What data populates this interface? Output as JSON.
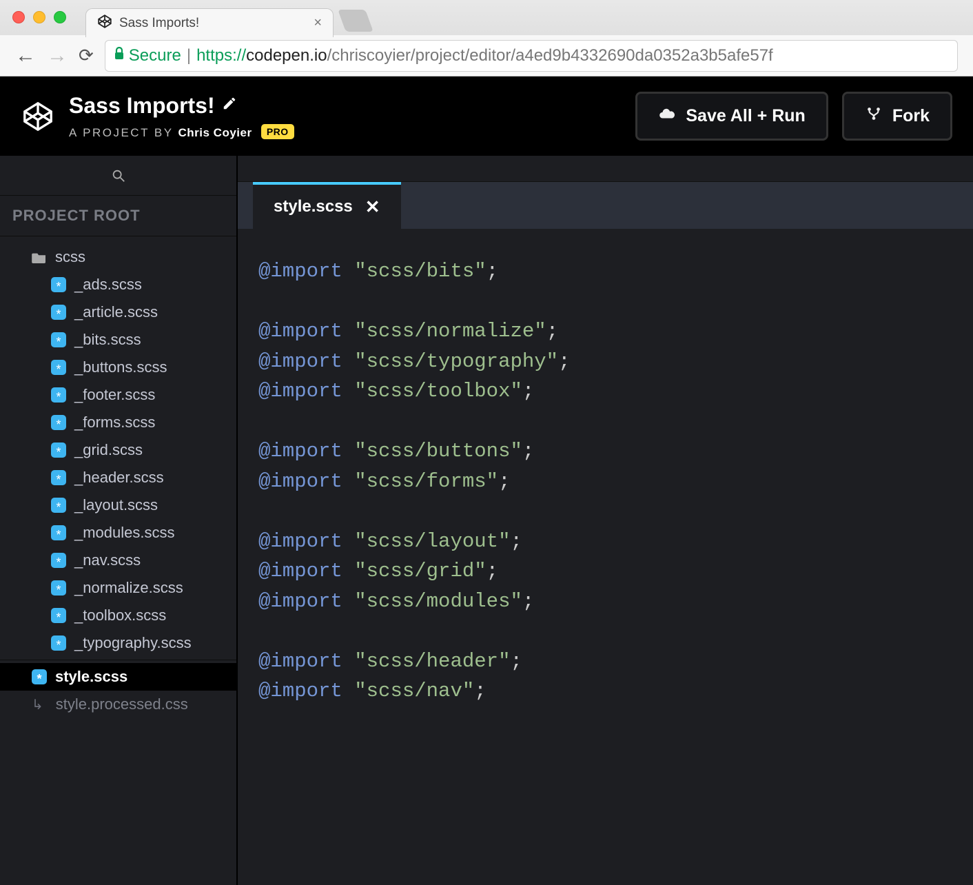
{
  "browser": {
    "tab_title": "Sass Imports!",
    "secure_label": "Secure",
    "url_proto": "https://",
    "url_host": "codepen.io",
    "url_path": "/chriscoyier/project/editor/a4ed9b4332690da0352a3b5afe57f"
  },
  "header": {
    "project_title": "Sass Imports!",
    "byline_prefix": "A PROJECT BY",
    "byline_author": "Chris Coyier",
    "pro_badge": "PRO",
    "save_button": "Save All + Run",
    "fork_button": "Fork"
  },
  "sidebar": {
    "root_label": "PROJECT ROOT",
    "folder": "scss",
    "files": [
      "_ads.scss",
      "_article.scss",
      "_bits.scss",
      "_buttons.scss",
      "_footer.scss",
      "_forms.scss",
      "_grid.scss",
      "_header.scss",
      "_layout.scss",
      "_modules.scss",
      "_nav.scss",
      "_normalize.scss",
      "_toolbox.scss",
      "_typography.scss"
    ],
    "selected_file": "style.scss",
    "processed_file": "style.processed.css"
  },
  "editor": {
    "open_tab": "style.scss",
    "code_lines": [
      {
        "kw": "@import",
        "str": "\"scss/bits\"",
        "tail": ";"
      },
      {
        "blank": true
      },
      {
        "kw": "@import",
        "str": "\"scss/normalize\"",
        "tail": ";"
      },
      {
        "kw": "@import",
        "str": "\"scss/typography\"",
        "tail": ";"
      },
      {
        "kw": "@import",
        "str": "\"scss/toolbox\"",
        "tail": ";"
      },
      {
        "blank": true
      },
      {
        "kw": "@import",
        "str": "\"scss/buttons\"",
        "tail": ";"
      },
      {
        "kw": "@import",
        "str": "\"scss/forms\"",
        "tail": ";"
      },
      {
        "blank": true
      },
      {
        "kw": "@import",
        "str": "\"scss/layout\"",
        "tail": ";"
      },
      {
        "kw": "@import",
        "str": "\"scss/grid\"",
        "tail": ";"
      },
      {
        "kw": "@import",
        "str": "\"scss/modules\"",
        "tail": ";"
      },
      {
        "blank": true
      },
      {
        "kw": "@import",
        "str": "\"scss/header\"",
        "tail": ";"
      },
      {
        "kw": "@import",
        "str": "\"scss/nav\"",
        "tail": ";"
      }
    ]
  }
}
